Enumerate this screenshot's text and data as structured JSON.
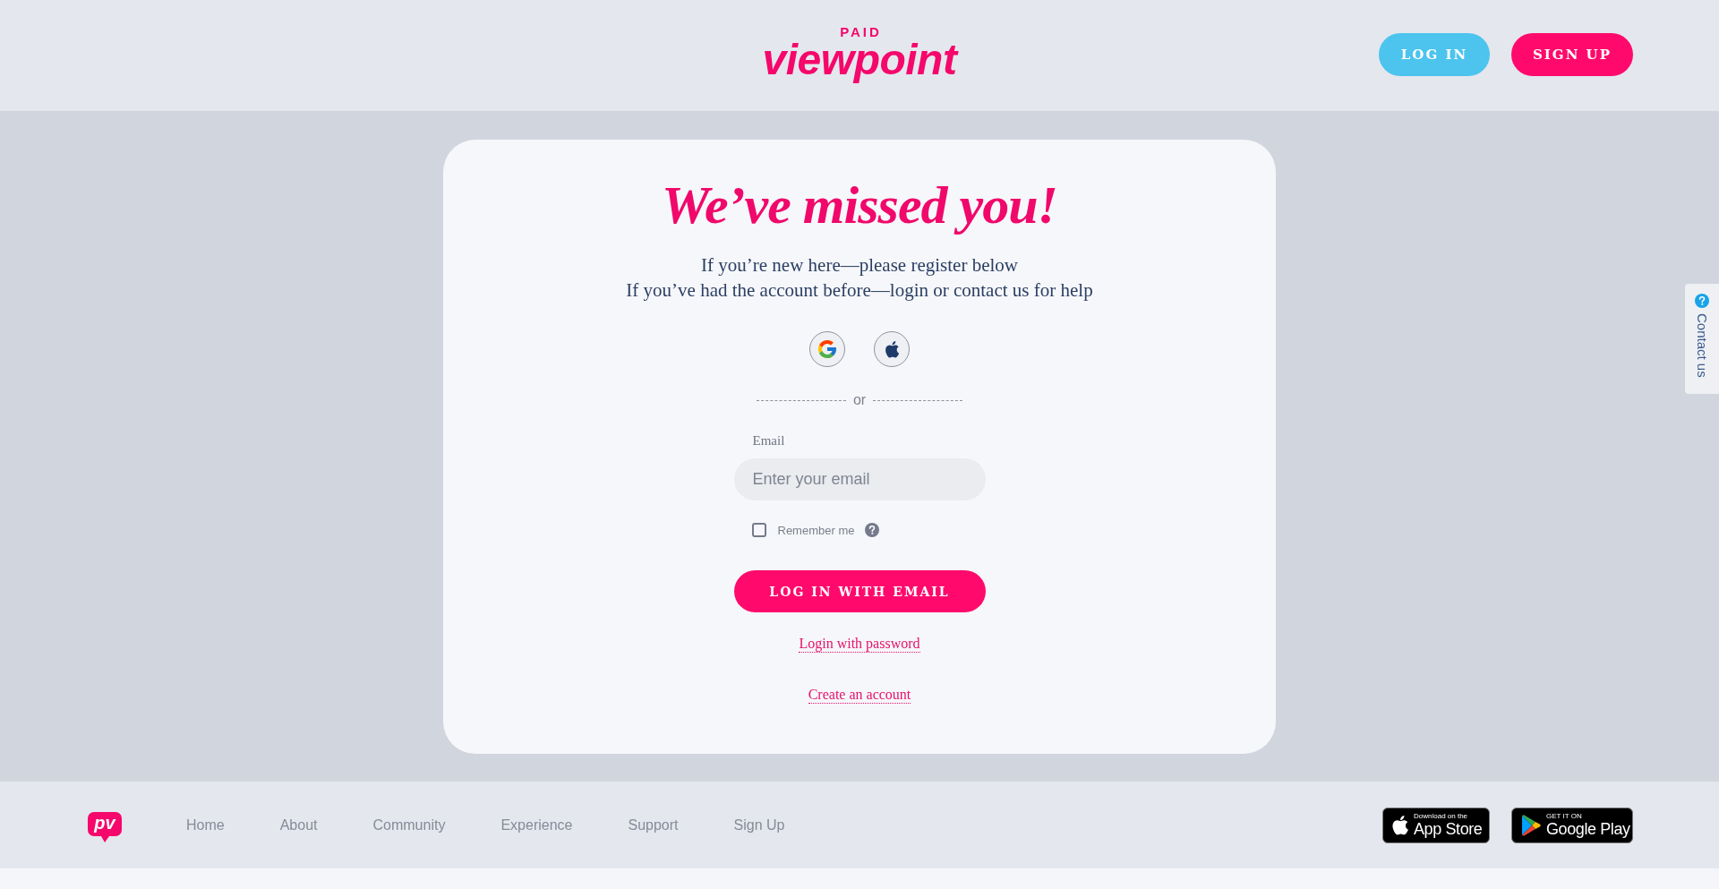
{
  "header": {
    "logo": {
      "tagline": "PAID",
      "wordmark": "viewpoint"
    },
    "buttons": [
      {
        "label": "LOG IN",
        "kind": "secondary"
      },
      {
        "label": "SIGN UP",
        "kind": "primary"
      }
    ]
  },
  "card": {
    "title": "We’ve missed you!",
    "intro": [
      "If you’re new here—please register below",
      "If you’ve had the account before—login or contact us for help"
    ],
    "social_buttons": [
      {
        "kind": "google"
      },
      {
        "kind": "apple"
      }
    ],
    "divider": "or",
    "email": {
      "label": "Email",
      "placeholder": "Enter your email"
    },
    "remember_me": {
      "label": "Remember me",
      "checked": false
    },
    "submit": "LOG IN WITH EMAIL",
    "links": [
      "Login with password",
      "Create an account"
    ]
  },
  "contact_tab": {
    "label": "Contact us"
  },
  "footer": {
    "logo": "pv",
    "nav": [
      "Home",
      "About",
      "Community",
      "Experience",
      "Support",
      "Sign Up"
    ],
    "store_badges": [
      {
        "kind": "apple",
        "small": "Download on the",
        "big": "App Store"
      },
      {
        "kind": "google",
        "small": "GET IT ON",
        "big": "Google Play"
      }
    ]
  }
}
